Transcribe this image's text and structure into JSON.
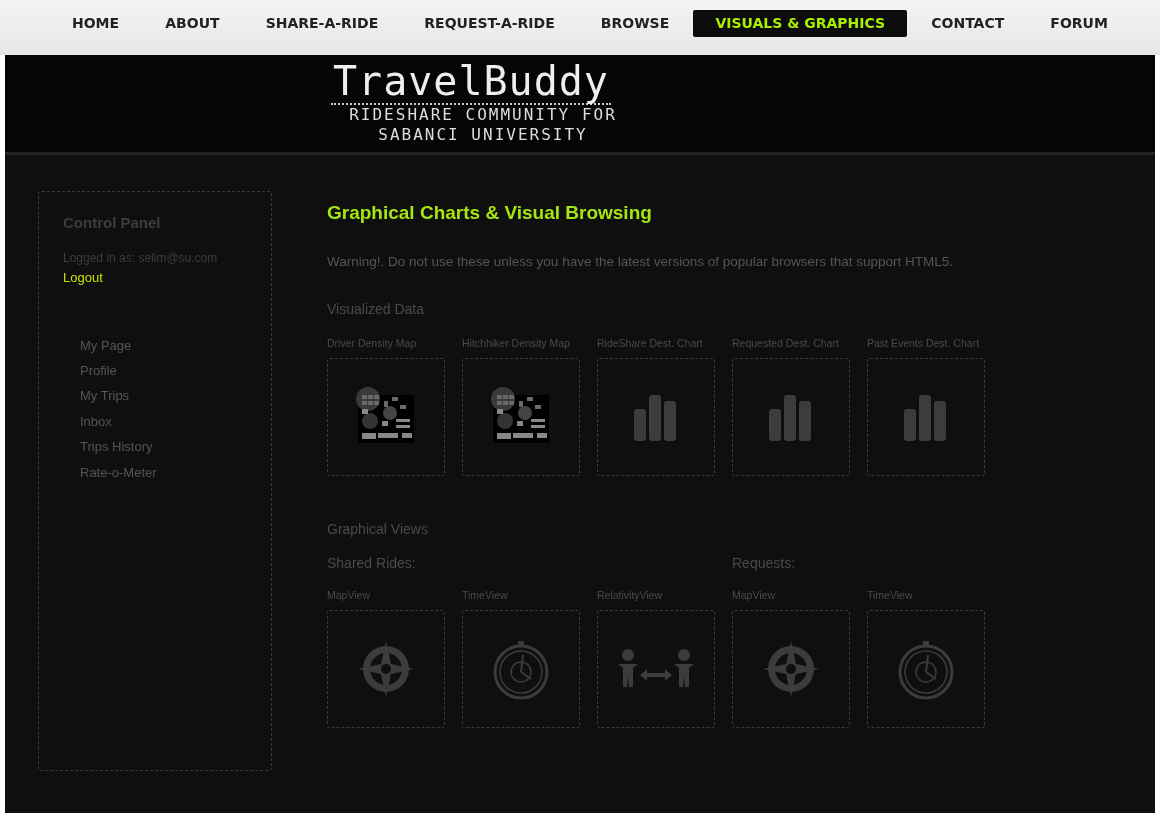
{
  "nav": [
    {
      "label": "HOME",
      "selected": false
    },
    {
      "label": "ABOUT",
      "selected": false
    },
    {
      "label": "SHARE-A-RIDE",
      "selected": false
    },
    {
      "label": "REQUEST-A-RIDE",
      "selected": false
    },
    {
      "label": "BROWSE",
      "selected": false
    },
    {
      "label": "VISUALS & GRAPHICS",
      "selected": true
    },
    {
      "label": "CONTACT",
      "selected": false
    },
    {
      "label": "FORUM",
      "selected": false
    }
  ],
  "header": {
    "logo": "TravelBuddy",
    "tagline": [
      "RIDESHARE COMMUNITY FOR",
      "SABANCI UNIVERSITY"
    ]
  },
  "sidebar": {
    "title": "Control Panel",
    "logged_in": "Logged in as: selim@su.com",
    "logout": "Logout",
    "items": [
      "My Page",
      "Profile",
      "My Trips",
      "Inbox",
      "Trips History",
      "Rate-o-Meter"
    ]
  },
  "main": {
    "heading": "Graphical Charts & Visual Browsing",
    "warning": "Warning!. Do not use these unless you have the latest versions of popular browsers that support HTML5.",
    "visualized": {
      "title": "Visualized Data",
      "tiles": [
        {
          "label": "Driver Density Map",
          "kind": "density"
        },
        {
          "label": "Hitchhiker Density Map",
          "kind": "density"
        },
        {
          "label": "RideShare Dest. Chart",
          "kind": "bars"
        },
        {
          "label": "Requested Dest. Chart",
          "kind": "bars"
        },
        {
          "label": "Past Events Dest. Chart",
          "kind": "bars"
        }
      ]
    },
    "views": {
      "title": "Graphical Views",
      "groups": [
        {
          "title": "Shared Rides:",
          "tiles": [
            {
              "label": "MapView",
              "kind": "compass"
            },
            {
              "label": "TimeView",
              "kind": "stopwatch"
            },
            {
              "label": "RelativityView",
              "kind": "people"
            }
          ]
        },
        {
          "title": "Requests:",
          "tiles": [
            {
              "label": "MapView",
              "kind": "compass"
            },
            {
              "label": "TimeView",
              "kind": "stopwatch"
            }
          ]
        }
      ]
    }
  }
}
